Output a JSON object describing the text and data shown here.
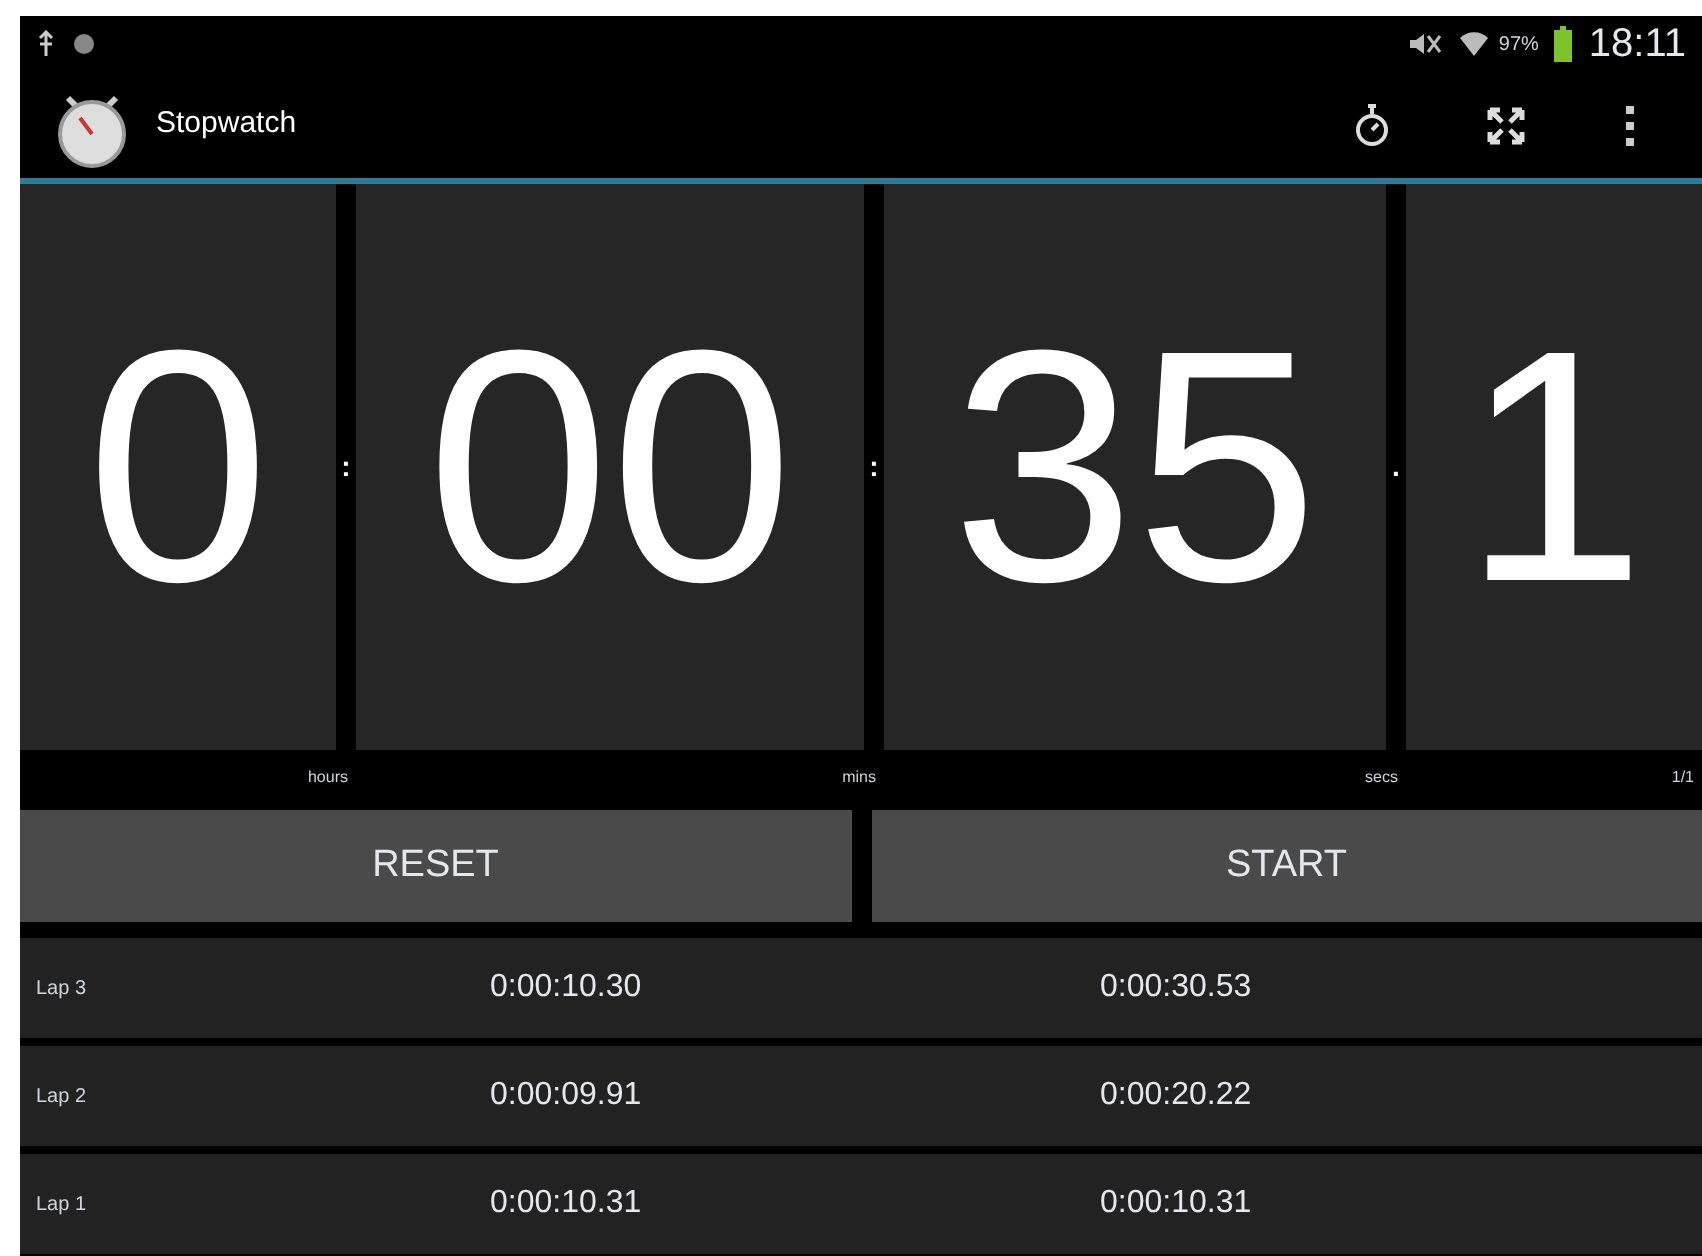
{
  "status_bar": {
    "battery_text": "97%",
    "time": "18:11"
  },
  "action_bar": {
    "title": "Stopwatch"
  },
  "display": {
    "segments": [
      {
        "value": "0",
        "unit": "hours",
        "separator": ":"
      },
      {
        "value": "00",
        "unit": "mins",
        "separator": ":"
      },
      {
        "value": "35",
        "unit": "secs",
        "separator": "."
      },
      {
        "value": "1",
        "unit": "1/1"
      }
    ]
  },
  "buttons": [
    "RESET",
    "START"
  ],
  "laps": [
    {
      "label": "Lap 3",
      "lap_time": "0:00:10.30",
      "total": "0:00:30.53"
    },
    {
      "label": "Lap 2",
      "lap_time": "0:00:09.91",
      "total": "0:00:20.22"
    },
    {
      "label": "Lap 1",
      "lap_time": "0:00:10.31",
      "total": "0:00:10.31"
    }
  ]
}
